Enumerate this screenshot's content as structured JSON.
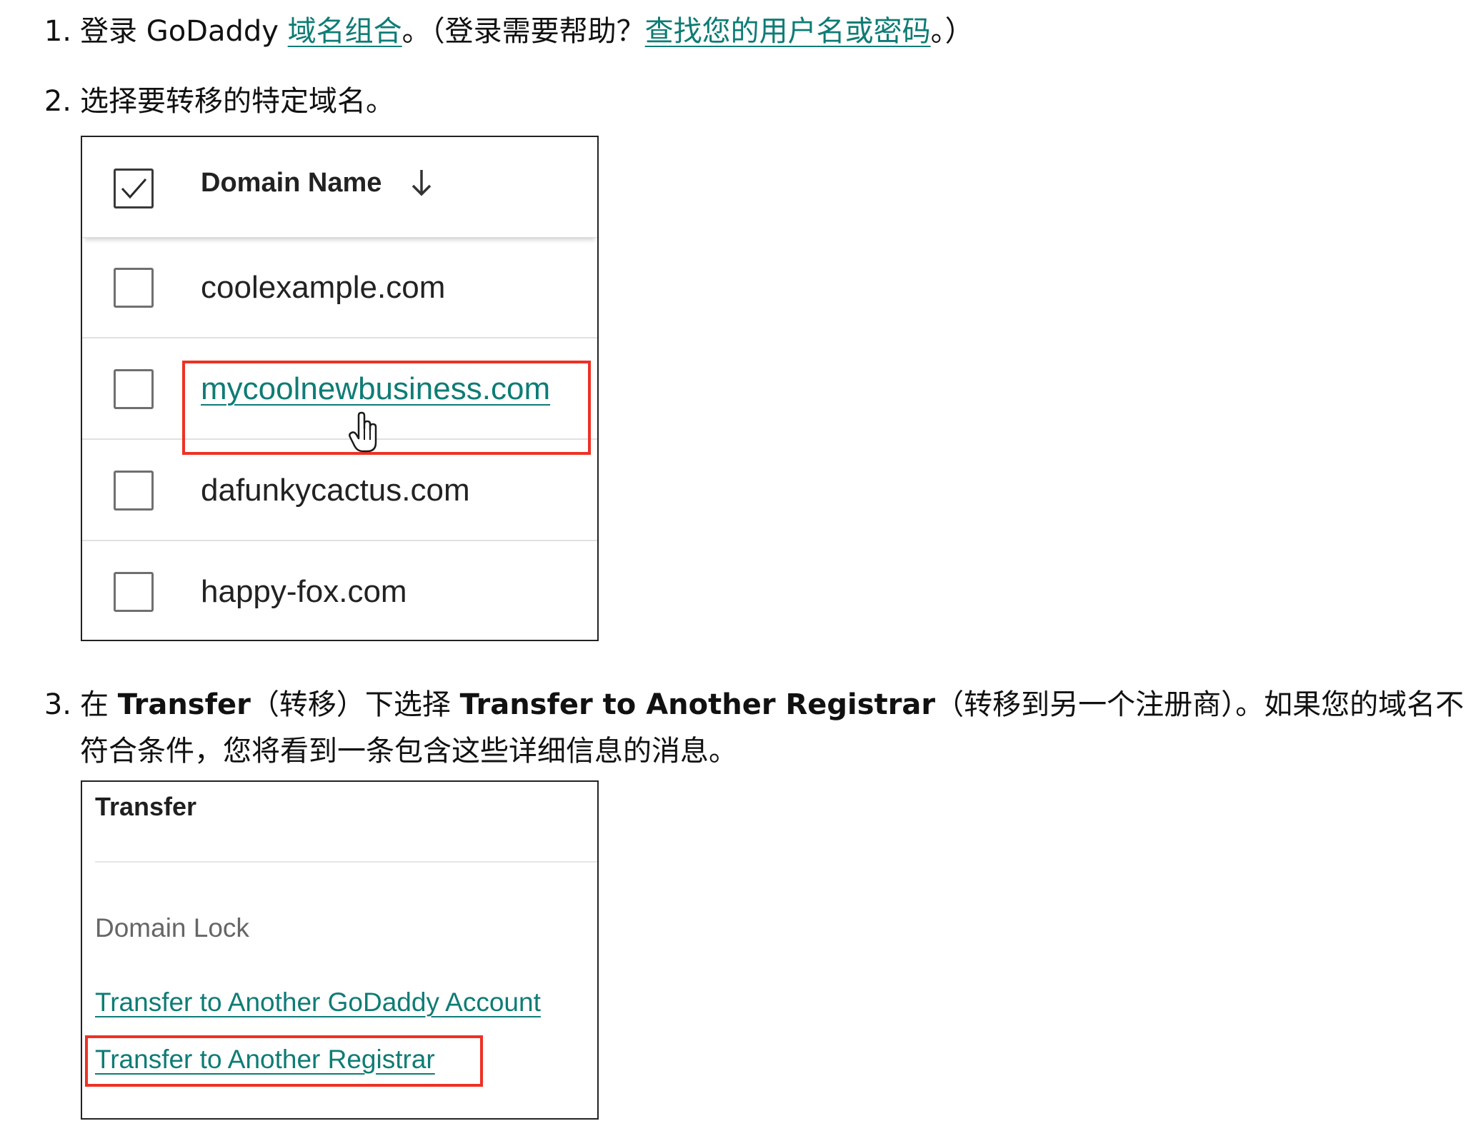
{
  "steps": [
    {
      "number": "1.",
      "text_a": "登录 GoDaddy ",
      "link_a": "域名组合",
      "text_b": "。（登录需要帮助？",
      "link_b": "查找您的用户名或密码",
      "text_c": "。）"
    },
    {
      "number": "2.",
      "text": "选择要转移的特定域名。"
    },
    {
      "number": "3.",
      "text_a": "在 ",
      "bold_a": "Transfer",
      "text_b": "（转移）下选择 ",
      "bold_b": "Transfer to Another Registrar",
      "text_c": "（转移到另一个注册商）。如果您的域名不",
      "line2": "符合条件，您将看到一条包含这些详细信息的消息。"
    }
  ],
  "domain_table": {
    "column_header": "Domain Name",
    "sort_icon": "arrow-down-icon",
    "select_all_checked": true,
    "rows": [
      {
        "domain": "coolexample.com",
        "is_link": false,
        "checked": false
      },
      {
        "domain": "mycoolnewbusiness.com",
        "is_link": true,
        "checked": false,
        "highlighted": true
      },
      {
        "domain": "dafunkycactus.com",
        "is_link": false,
        "checked": false
      },
      {
        "domain": "happy-fox.com",
        "is_link": false,
        "checked": false
      }
    ],
    "cursor_icon": "hand-pointer-icon"
  },
  "transfer_panel": {
    "title": "Transfer",
    "domain_lock": "Domain Lock",
    "link_account": "Transfer to Another GoDaddy Account",
    "link_registrar": "Transfer to Another Registrar",
    "highlighted": "link_registrar"
  },
  "colors": {
    "link": "#0e7c75",
    "highlight": "#ee3124",
    "text": "#111111"
  }
}
